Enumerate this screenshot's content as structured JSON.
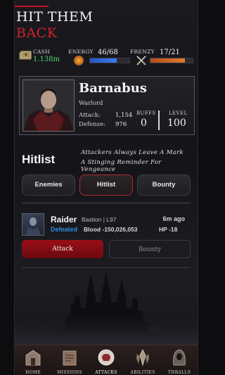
{
  "promo": {
    "title_line1": "HIT THEM",
    "title_line2": "BACK"
  },
  "stats": {
    "cash_label": "CASH",
    "cash_value": "1.138m",
    "energy_label": "ENERGY",
    "energy_value": "46/68",
    "energy_fraction": 0.68,
    "frenzy_label": "FRENZY",
    "frenzy_value": "17/21",
    "frenzy_fraction": 0.81
  },
  "profile": {
    "name": "Barnabus",
    "class": "Warlord",
    "attack_label": "Attack:",
    "attack_value": "1,154",
    "defense_label": "Defense:",
    "defense_value": "976",
    "buffs_label": "BUFFS",
    "buffs_value": "0",
    "level_label": "LEVEL",
    "level_value": "100"
  },
  "hitlist": {
    "title": "Hitlist",
    "tagline_line1": "Attackers Always Leave A Mark",
    "tagline_line2": "A Stinging Reminder For Vengeance",
    "tabs": [
      {
        "label": "Enemies"
      },
      {
        "label": "Hitlist"
      },
      {
        "label": "Bounty"
      }
    ],
    "active_tab": "Hitlist"
  },
  "entry": {
    "name": "Raider",
    "tag": "Bastion | L97",
    "time": "6m ago",
    "status": "Defeated",
    "blood": "Blood -150,026,053",
    "hp": "HP -18",
    "attack_label": "Attack",
    "bounty_label": "Bounty"
  },
  "nav": {
    "items": [
      {
        "label": "HOME",
        "icon": "home-icon"
      },
      {
        "label": "MISSIONS",
        "icon": "missions-icon"
      },
      {
        "label": "ATTACKS",
        "icon": "attacks-icon"
      },
      {
        "label": "ABILITIES",
        "icon": "abilities-icon"
      },
      {
        "label": "THRALLS",
        "icon": "thralls-icon"
      }
    ],
    "active": "ATTACKS"
  },
  "colors": {
    "accent_red": "#c4121f",
    "cash_green": "#4fd86b",
    "defeated_blue": "#2f8de0",
    "energy_blue": "#3b7bf0",
    "frenzy_orange": "#e07a2c"
  }
}
